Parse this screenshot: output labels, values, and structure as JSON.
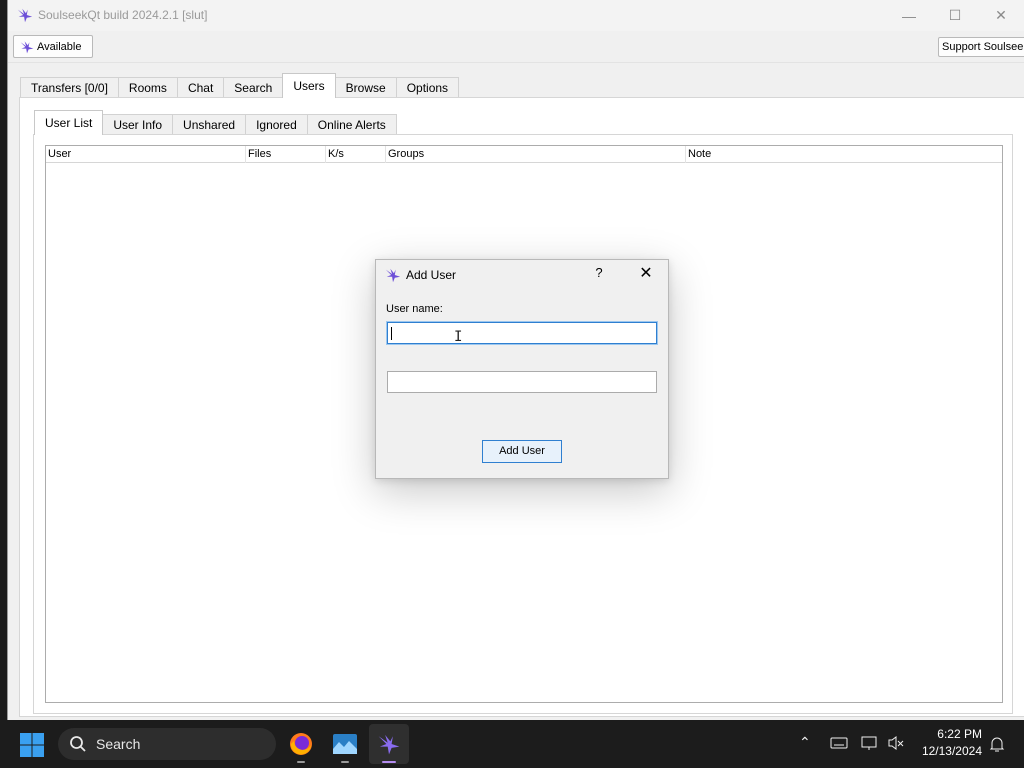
{
  "window": {
    "title": "SoulseekQt build 2024.2.1 [slut]",
    "controls": {
      "minimize": "—",
      "maximize": "☐",
      "close": "✕"
    }
  },
  "toolbar": {
    "status_label": "Available",
    "support_label": "Support Soulseek"
  },
  "main_tabs": [
    {
      "label": "Transfers [0/0]",
      "active": false
    },
    {
      "label": "Rooms",
      "active": false
    },
    {
      "label": "Chat",
      "active": false
    },
    {
      "label": "Search",
      "active": false
    },
    {
      "label": "Users",
      "active": true
    },
    {
      "label": "Browse",
      "active": false
    },
    {
      "label": "Options",
      "active": false
    }
  ],
  "sub_tabs": [
    {
      "label": "User List",
      "active": true
    },
    {
      "label": "User Info",
      "active": false
    },
    {
      "label": "Unshared",
      "active": false
    },
    {
      "label": "Ignored",
      "active": false
    },
    {
      "label": "Online Alerts",
      "active": false
    }
  ],
  "user_table": {
    "columns": [
      "User",
      "Files",
      "K/s",
      "Groups",
      "Note"
    ],
    "rows": []
  },
  "dialog": {
    "title": "Add User",
    "help": "?",
    "close": "✕",
    "username_label": "User name:",
    "username_value": "",
    "second_value": "",
    "submit_label": "Add User"
  },
  "taskbar": {
    "search_label": "Search",
    "time": "6:22 PM",
    "date": "12/13/2024"
  },
  "colors": {
    "accent": "#2f7fd0",
    "soulseek_bird": "#6d4fd8",
    "taskbar": "#1c1c1c"
  }
}
